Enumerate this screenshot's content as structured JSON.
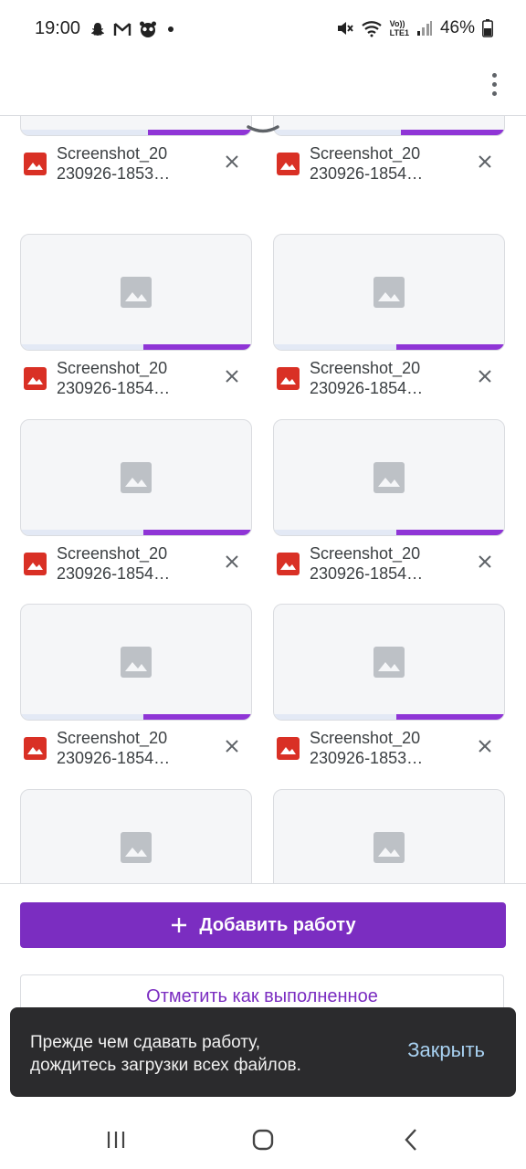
{
  "status_bar": {
    "time": "19:00",
    "left_icons": [
      "snapchat-icon",
      "gmail-icon",
      "panda-app-icon",
      "dot-icon"
    ],
    "right_icons": [
      "mute-icon",
      "wifi-icon",
      "volte-icon",
      "signal-icon"
    ],
    "network_label_top": "Vo))",
    "network_label_bottom": "LTE1",
    "battery": "46%"
  },
  "appbar": {
    "menu_icon": "more-vert-icon"
  },
  "files": [
    {
      "name": "Screenshot_20\n230926-1853…",
      "progress": 0.45
    },
    {
      "name": "Screenshot_20\n230926-1854…",
      "progress": 0.45
    },
    {
      "name": "Screenshot_20\n230926-1854…",
      "progress": 0.47
    },
    {
      "name": "Screenshot_20\n230926-1854…",
      "progress": 0.47
    },
    {
      "name": "Screenshot_20\n230926-1854…",
      "progress": 0.47
    },
    {
      "name": "Screenshot_20\n230926-1854…",
      "progress": 0.47
    },
    {
      "name": "Screenshot_20\n230926-1854…",
      "progress": 0.47
    },
    {
      "name": "Screenshot_20\n230926-1853…",
      "progress": 0.47
    },
    {
      "name": "",
      "progress": 0
    },
    {
      "name": "",
      "progress": 0
    }
  ],
  "add_button": {
    "label": "Добавить работу",
    "icon": "plus-icon"
  },
  "mark_done_button": {
    "label": "Отметить как выполненное"
  },
  "snackbar": {
    "line1": "Прежде чем сдавать работу,",
    "line2": "дождитесь загрузки всех файлов.",
    "action": "Закрыть"
  },
  "colors": {
    "accent": "#7b2dc1",
    "progress": "#8f35d6",
    "file_icon": "#d93025",
    "snackbar_bg": "#2b2b2d",
    "snackbar_action": "#a8d1f1"
  }
}
